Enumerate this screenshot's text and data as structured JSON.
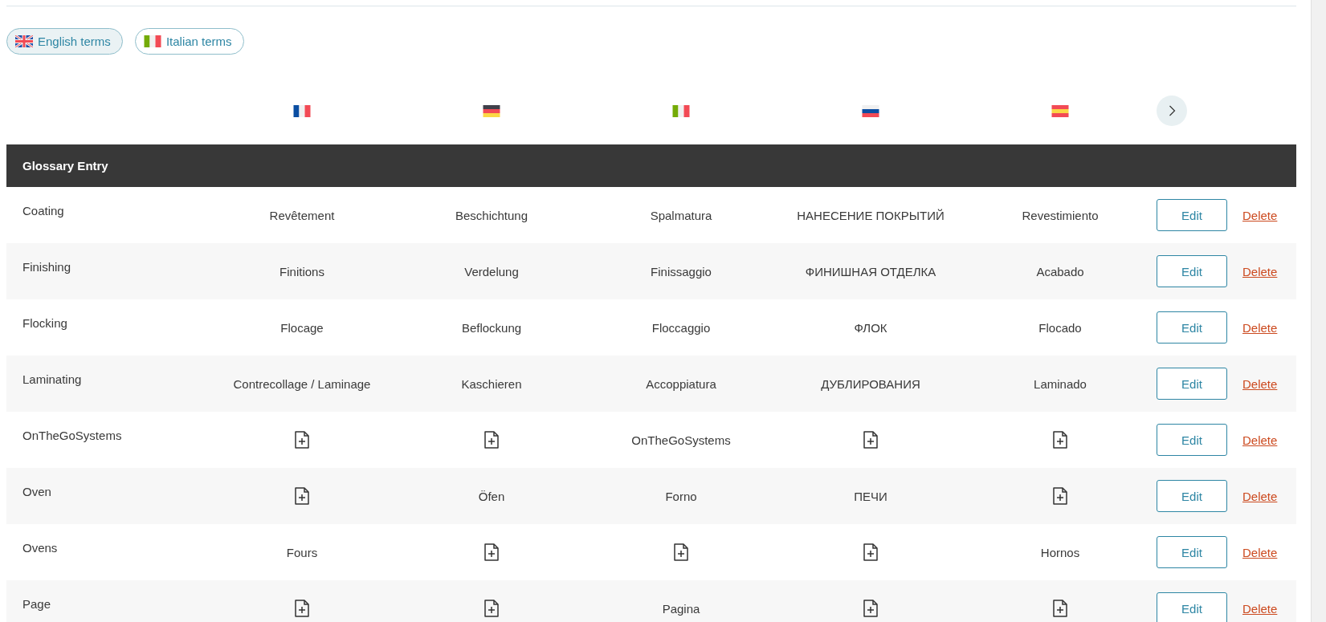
{
  "term_filters": [
    {
      "label": "English terms",
      "kind": "gb",
      "selected": true
    },
    {
      "label": "Italian terms",
      "kind": "it",
      "selected": false
    }
  ],
  "language_columns": [
    {
      "kind": "fr"
    },
    {
      "kind": "de"
    },
    {
      "kind": "it"
    },
    {
      "kind": "ru"
    },
    {
      "kind": "es"
    }
  ],
  "table": {
    "header": "Glossary Entry",
    "rows": [
      {
        "entry": "Coating",
        "cells": [
          {
            "kind": "text",
            "text": "Revêtement"
          },
          {
            "kind": "text",
            "text": "Beschichtung"
          },
          {
            "kind": "text",
            "text": "Spalmatura"
          },
          {
            "kind": "text",
            "text": "НАНЕСЕНИЕ ПОКРЫТИЙ"
          },
          {
            "kind": "text",
            "text": "Revestimiento"
          }
        ],
        "edit": "Edit",
        "delete": "Delete"
      },
      {
        "entry": "Finishing",
        "cells": [
          {
            "kind": "text",
            "text": "Finitions"
          },
          {
            "kind": "text",
            "text": "Verdelung"
          },
          {
            "kind": "text",
            "text": "Finissaggio"
          },
          {
            "kind": "text",
            "text": "ФИНИШНАЯ ОТДЕЛКА"
          },
          {
            "kind": "text",
            "text": "Acabado"
          }
        ],
        "edit": "Edit",
        "delete": "Delete"
      },
      {
        "entry": "Flocking",
        "cells": [
          {
            "kind": "text",
            "text": "Flocage"
          },
          {
            "kind": "text",
            "text": "Beflockung"
          },
          {
            "kind": "text",
            "text": "Floccaggio"
          },
          {
            "kind": "text",
            "text": "ФЛОК"
          },
          {
            "kind": "text",
            "text": "Flocado"
          }
        ],
        "edit": "Edit",
        "delete": "Delete"
      },
      {
        "entry": "Laminating",
        "cells": [
          {
            "kind": "text",
            "text": "Contrecollage / Laminage"
          },
          {
            "kind": "text",
            "text": "Kaschieren"
          },
          {
            "kind": "text",
            "text": "Accoppiatura"
          },
          {
            "kind": "text",
            "text": "ДУБЛИРОВАНИЯ"
          },
          {
            "kind": "text",
            "text": "Laminado"
          }
        ],
        "edit": "Edit",
        "delete": "Delete"
      },
      {
        "entry": "OnTheGoSystems",
        "cells": [
          {
            "kind": "add"
          },
          {
            "kind": "add"
          },
          {
            "kind": "text",
            "text": "OnTheGoSystems"
          },
          {
            "kind": "add"
          },
          {
            "kind": "add"
          }
        ],
        "edit": "Edit",
        "delete": "Delete"
      },
      {
        "entry": "Oven",
        "cells": [
          {
            "kind": "add"
          },
          {
            "kind": "text",
            "text": "Öfen"
          },
          {
            "kind": "text",
            "text": "Forno"
          },
          {
            "kind": "text",
            "text": "ПЕЧИ"
          },
          {
            "kind": "add"
          }
        ],
        "edit": "Edit",
        "delete": "Delete"
      },
      {
        "entry": "Ovens",
        "cells": [
          {
            "kind": "text",
            "text": "Fours"
          },
          {
            "kind": "add"
          },
          {
            "kind": "add"
          },
          {
            "kind": "add"
          },
          {
            "kind": "text",
            "text": "Hornos"
          }
        ],
        "edit": "Edit",
        "delete": "Delete"
      },
      {
        "entry": "Page",
        "cells": [
          {
            "kind": "add"
          },
          {
            "kind": "add"
          },
          {
            "kind": "text",
            "text": "Pagina"
          },
          {
            "kind": "add"
          },
          {
            "kind": "add"
          }
        ],
        "edit": "Edit",
        "delete": "Delete"
      }
    ]
  }
}
